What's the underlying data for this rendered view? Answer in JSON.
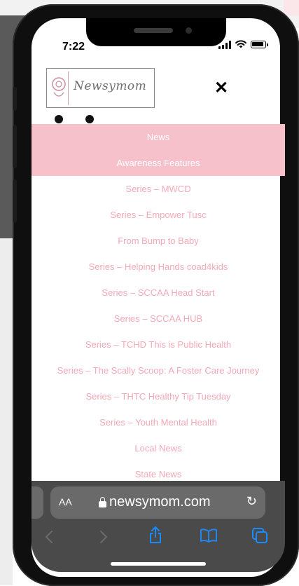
{
  "status_bar": {
    "time": "7:22"
  },
  "site": {
    "logo_text": "Newsymom",
    "close_label": "✕"
  },
  "menu": {
    "highlighted": [
      "News",
      "Awareness Features"
    ],
    "items": [
      "Series – MWCD",
      "Series – Empower Tusc",
      "From Bump to Baby",
      "Series – Helping Hands coad4kids",
      "Series – SCCAA Head Start",
      "Series – SCCAA HUB",
      "Series – TCHD This is Public Health",
      "Series – The Scally Scoop: A Foster Care Journey",
      "Series – THTC Healthy Tip Tuesday",
      "Series – Youth Mental Health",
      "Local News",
      "State News"
    ]
  },
  "browser": {
    "aa_label": "AA",
    "url": "newsymom.com",
    "reload_glyph": "↻"
  },
  "colors": {
    "menu_band_bg": "#f6c1cb",
    "menu_text": "#f3a9b7",
    "chrome_bg": "#4a4a4a",
    "toolbar_accent": "#1a8cff"
  }
}
